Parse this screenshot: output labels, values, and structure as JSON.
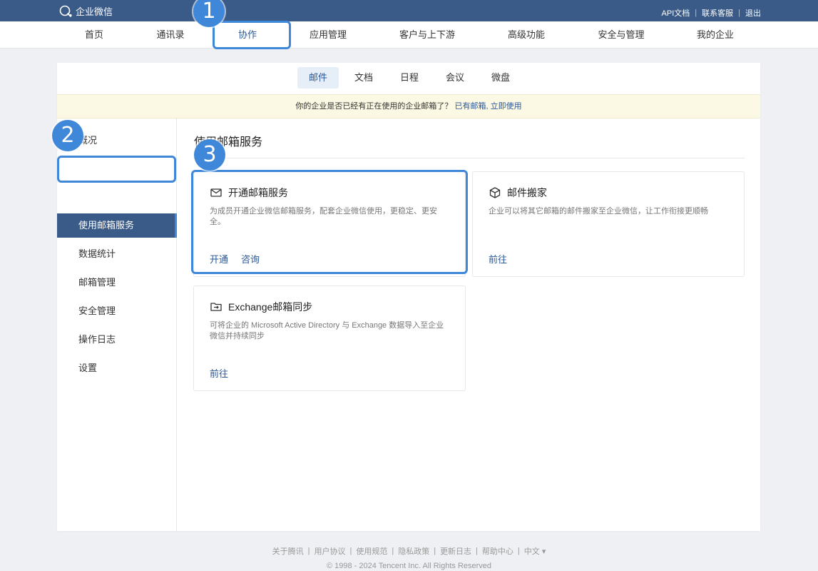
{
  "app": {
    "logo_text": "企业微信"
  },
  "top_links": [
    "API文档",
    "联系客服",
    "退出"
  ],
  "main_nav": [
    {
      "label": "首页"
    },
    {
      "label": "通讯录"
    },
    {
      "label": "协作",
      "active": true
    },
    {
      "label": "应用管理"
    },
    {
      "label": "客户与上下游"
    },
    {
      "label": "高级功能"
    },
    {
      "label": "安全与管理"
    },
    {
      "label": "我的企业"
    }
  ],
  "sub_tabs": [
    {
      "label": "邮件",
      "active": true
    },
    {
      "label": "文档"
    },
    {
      "label": "日程"
    },
    {
      "label": "会议"
    },
    {
      "label": "微盘"
    }
  ],
  "notice": {
    "text": "你的企业是否已经有正在使用的企业邮箱了？",
    "link": "已有邮箱, 立即使用"
  },
  "sidebar": {
    "items": [
      {
        "label": "概况"
      },
      {
        "label": "使用邮箱服务",
        "active": true
      },
      {
        "label": "数据统计"
      },
      {
        "label": "邮箱管理"
      },
      {
        "label": "安全管理"
      },
      {
        "label": "操作日志"
      },
      {
        "label": "设置"
      }
    ]
  },
  "content": {
    "title": "使用邮箱服务",
    "cards": [
      {
        "icon": "mail-icon",
        "title": "开通邮箱服务",
        "desc": "为成员开通企业微信邮箱服务，配套企业微信使用，更稳定、更安全。",
        "actions": [
          "开通",
          "咨询"
        ]
      },
      {
        "icon": "box-icon",
        "title": "邮件搬家",
        "desc": "企业可以将其它邮箱的邮件搬家至企业微信，让工作衔接更顺畅",
        "actions": [
          "前往"
        ]
      },
      {
        "icon": "folder-sync-icon",
        "title": "Exchange邮箱同步",
        "desc": "可将企业的 Microsoft Active Directory 与 Exchange 数据导入至企业微信并持续同步",
        "actions": [
          "前往"
        ]
      }
    ]
  },
  "annotations": {
    "badges": [
      "1",
      "2",
      "3"
    ],
    "color": "#3f87d9"
  },
  "footer": {
    "links": [
      "关于腾讯",
      "用户协议",
      "使用规范",
      "隐私政策",
      "更新日志",
      "帮助中心"
    ],
    "language": "中文 ▾",
    "copyright": "© 1998 - 2024 Tencent Inc. All Rights Reserved"
  },
  "colors": {
    "topbar": "#3a5a87",
    "accent": "#2b5797",
    "highlight": "#3f87d9",
    "notice_bg": "#fbf8e3"
  }
}
